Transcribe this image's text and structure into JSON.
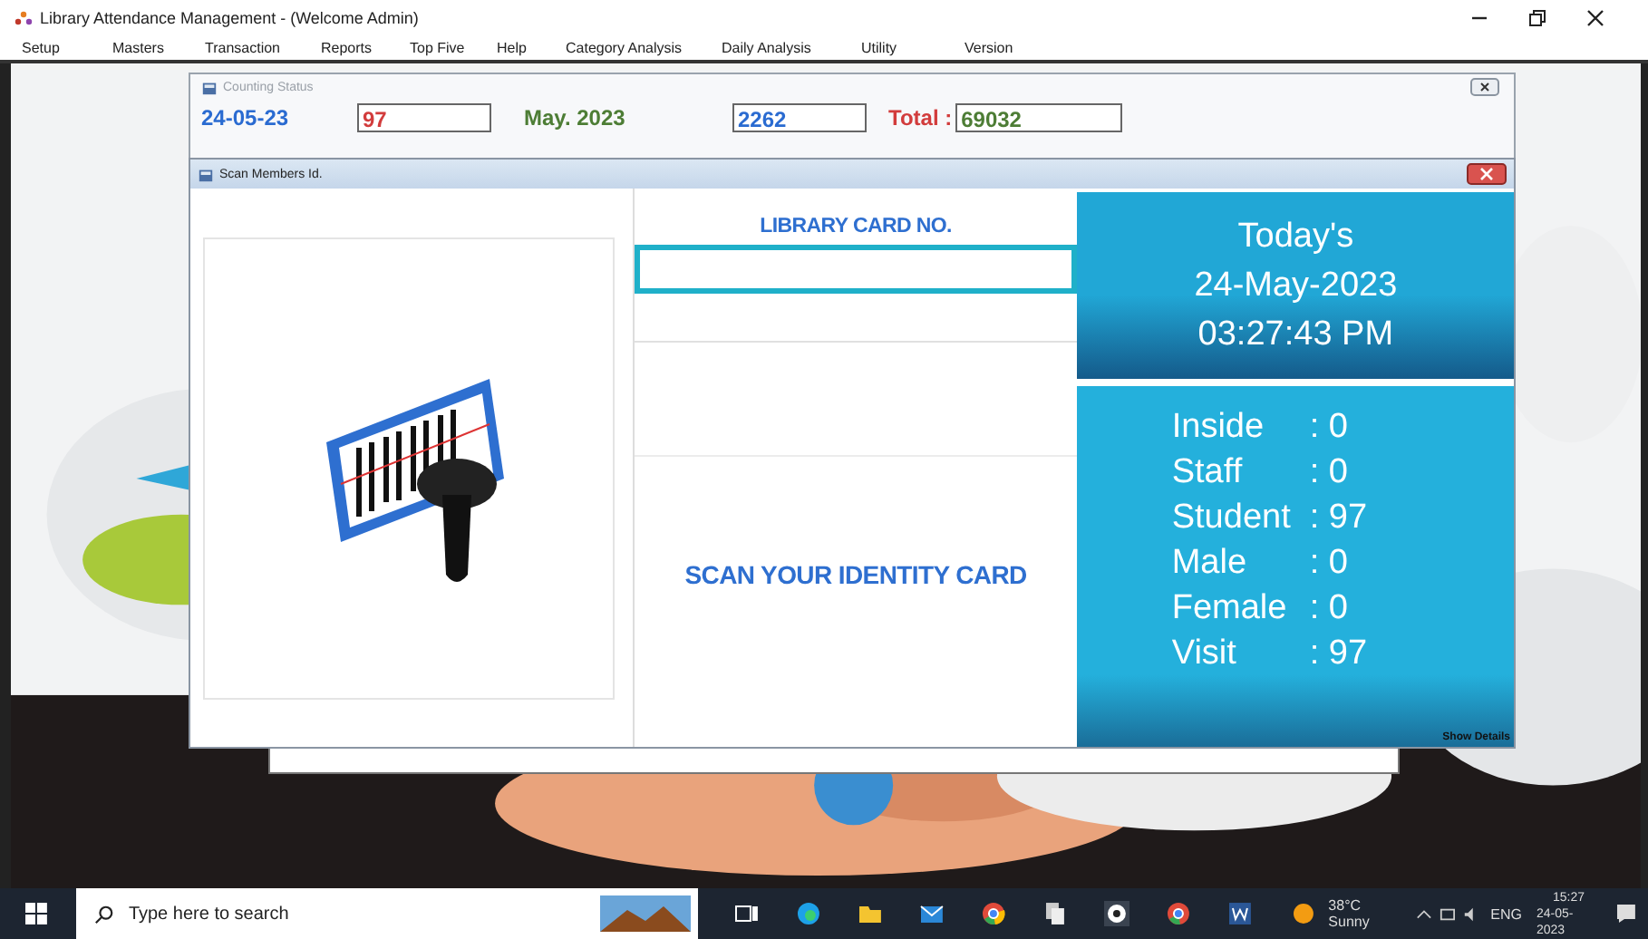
{
  "window": {
    "title": "Library Attendance Management - (Welcome Admin)"
  },
  "menu": [
    {
      "label": "Setup"
    },
    {
      "label": "Masters"
    },
    {
      "label": "Transaction"
    },
    {
      "label": "Reports"
    },
    {
      "label": "Top Five"
    },
    {
      "label": "Help"
    },
    {
      "label": "Category Analysis"
    },
    {
      "label": "Daily Analysis"
    },
    {
      "label": "Utility"
    },
    {
      "label": "Version"
    }
  ],
  "counting_status": {
    "title": "Counting Status",
    "date": "24-05-23",
    "today_count": "97",
    "month": "May. 2023",
    "month_count": "2262",
    "total_label": "Total :",
    "total": "69032"
  },
  "scan_window": {
    "title": "Scan Members Id.",
    "card_label": "LIBRARY CARD NO.",
    "prompt": "SCAN YOUR IDENTITY CARD",
    "today": {
      "heading": "Today's",
      "date": "24-May-2023",
      "time": "03:27:43 PM"
    },
    "stats": [
      {
        "label": "Inside",
        "value": ": 0"
      },
      {
        "label": "Staff",
        "value": ": 0"
      },
      {
        "label": "Student",
        "value": ": 97"
      },
      {
        "label": "Male",
        "value": ": 0"
      },
      {
        "label": "Female",
        "value": ": 0"
      },
      {
        "label": "Visit",
        "value": ": 97"
      }
    ],
    "show_details": "Show Details"
  },
  "taskbar": {
    "search_placeholder": "Type here to search",
    "weather": "38°C Sunny",
    "language": "ENG",
    "time": "15:27",
    "date": "24-05-2023"
  }
}
